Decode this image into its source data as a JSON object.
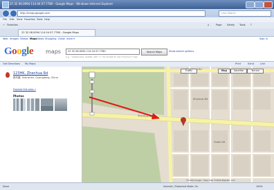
{
  "window": {
    "title": "37.32 06.0094 114.04 07.7780 - Google Maps - Windows Internet Explorer"
  },
  "browser": {
    "address": "http://maps.google.com",
    "live_search_placeholder": "Live Search",
    "menu": [
      "File",
      "Edit",
      "View",
      "Favorites",
      "Tools",
      "Help"
    ],
    "favorites_label": "Favorites",
    "tab_title": "22 32 06.0094 114 04 07.7780 - Google Maps",
    "toolbar": [
      "Page",
      "Safety",
      "Tools"
    ]
  },
  "gbar": {
    "links": [
      "Web",
      "Images",
      "Videos",
      "Maps",
      "News",
      "Shopping",
      "Gmail",
      "more ▾"
    ],
    "signin": "Sign in"
  },
  "search": {
    "logo": "Google",
    "logo_suffix": "maps",
    "query": "22 32 06.0094 114 04 07.7780",
    "button_label": "Search Maps",
    "options_link": "Show search options",
    "subtext": "e.g., \"restaurants, Seattle, WA\" or \"10 market St, San Francisco\" help"
  },
  "bluebar": {
    "links": [
      "Get Directions",
      "My Maps"
    ],
    "right_links": [
      "Print",
      "Send",
      "Link"
    ]
  },
  "result": {
    "title": "123HK, Zhenhua Rd",
    "address": "振华路, Shenzhen, Guangdong, China",
    "link": "Explore this area »",
    "photos_label": "Photos"
  },
  "map": {
    "buttons": [
      "Traffic",
      "Map",
      "Satellite",
      "Terrain"
    ],
    "labels": [
      "Huaqiang Rd",
      "Zhenhua Rd",
      "Zhenhua Rd",
      "Huafu Rd"
    ],
    "copyright": "©2009 Google - Map data ©2009 Mapabc.com",
    "colors": {
      "park": "#bfcfa5",
      "road_major": "#f7f3a6",
      "road_minor": "#ffffff",
      "block": "#e4ddd0",
      "arrow": "#e01818",
      "pin": "#b5352a"
    }
  },
  "status": {
    "left": "Done",
    "zone": "Internet | Protected Mode: On",
    "zoom": "100%"
  }
}
